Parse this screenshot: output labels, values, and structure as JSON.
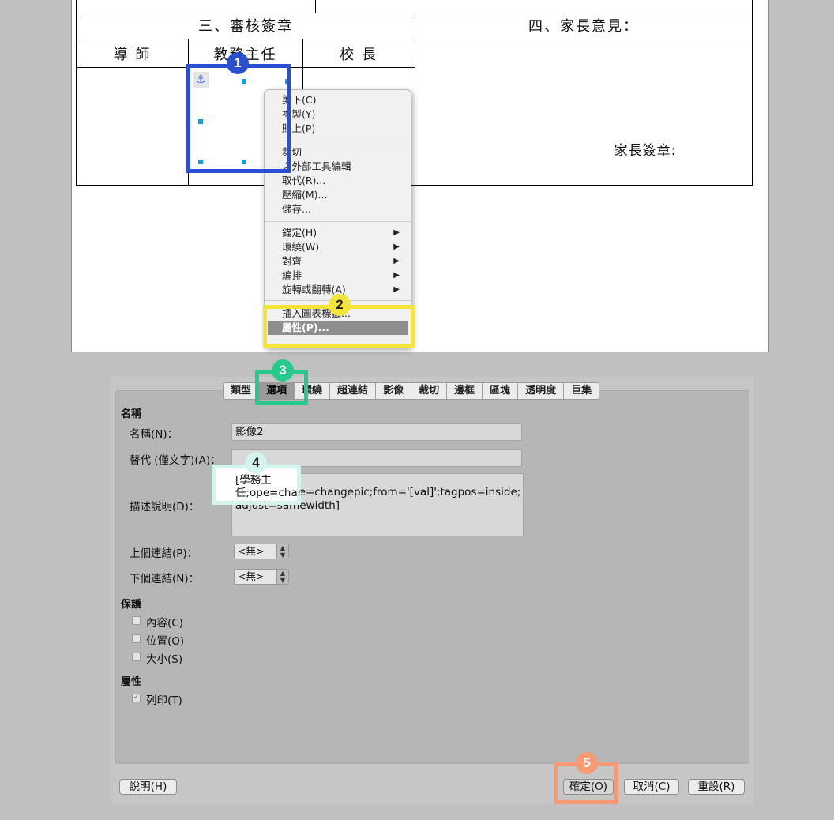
{
  "document": {
    "section3_header": "三、審核簽章",
    "section4_header": "四、家長意見：",
    "col_tutor": "導 師",
    "col_academic_director": "教務主任",
    "col_principal": "校 長",
    "parent_signature": "家長簽章:"
  },
  "context_menu": {
    "group1": [
      "剪下(C)",
      "複製(Y)",
      "貼上(P)"
    ],
    "group2": [
      "裁切",
      "以外部工具編輯",
      "取代(R)...",
      "壓縮(M)...",
      "儲存..."
    ],
    "group3": [
      "錨定(H)",
      "環繞(W)",
      "對齊",
      "編排",
      "旋轉或翻轉(A)"
    ],
    "group4": [
      "插入圖表標籤...",
      "屬性(P)..."
    ]
  },
  "dialog": {
    "tabs": [
      "類型",
      "選項",
      "環繞",
      "超連結",
      "影像",
      "裁切",
      "邊框",
      "區塊",
      "透明度",
      "巨集"
    ],
    "active_tab": "選項",
    "section_name": "名稱",
    "name_label": "名稱(N)：",
    "name_value": "影像2",
    "alt_label": "替代 (僅文字)(A)：",
    "alt_value": "",
    "desc_label": "描述說明(D)：",
    "desc_value": "[學務主任;ope=changepic;from='[val]';tagpos=inside;adjust=samewidth]",
    "prev_link_label": "上個連結(P)：",
    "prev_link_value": "<無>",
    "next_link_label": "下個連結(N)：",
    "next_link_value": "<無>",
    "section_protect": "保護",
    "protect_content": "內容(C)",
    "protect_position": "位置(O)",
    "protect_size": "大小(S)",
    "section_props": "屬性",
    "print_label": "列印(T)",
    "print_checked": true,
    "help_button": "說明(H)",
    "ok_button": "確定(O)",
    "cancel_button": "取消(C)",
    "reset_button": "重設(R)"
  },
  "callouts": {
    "badge1": "1",
    "badge2": "2",
    "badge3": "3",
    "badge4": "4",
    "badge5": "5",
    "callout4_text_line1": "[學務主",
    "callout4_text_line2": "任;ope=char",
    "colors": {
      "c1": "#2a4fd0",
      "c2": "#f3e53a",
      "c3": "#27c98c",
      "c4": "#d4f4ee",
      "c5": "#f59a72"
    }
  }
}
